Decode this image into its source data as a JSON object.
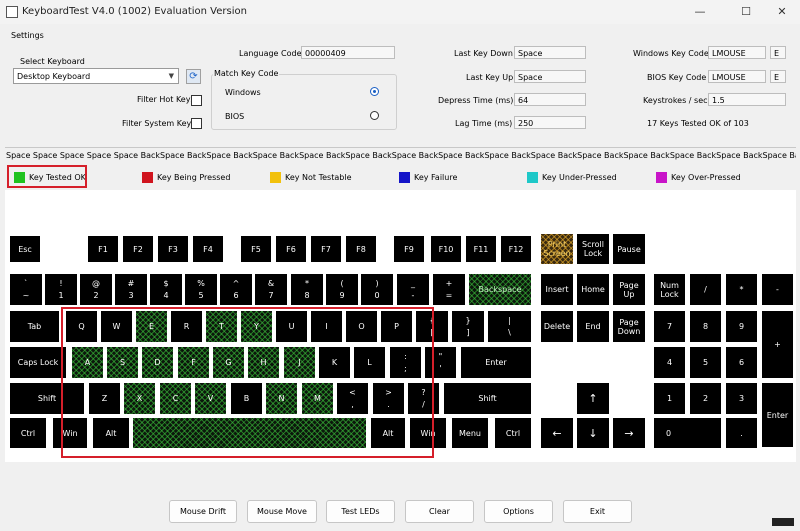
{
  "window": {
    "title": "KeyboardTest V4.0 (1002) Evaluation Version",
    "minimize": "—",
    "maximize": "☐",
    "close": "✕"
  },
  "settings": {
    "legend": "Settings",
    "select_keyboard_label": "Select Keyboard",
    "keyboard_value": "Desktop Keyboard",
    "filter_hot_keys": "Filter Hot Keys",
    "filter_system_keys": "Filter System Keys",
    "language_code_label": "Language Code",
    "language_code": "00000409",
    "match_key_code_label": "Match Key Code",
    "match_windows": "Windows",
    "match_bios": "BIOS",
    "last_key_down_label": "Last Key Down",
    "last_key_down": "Space",
    "last_key_up_label": "Last Key Up",
    "last_key_up": "Space",
    "depress_time_label": "Depress Time (ms)",
    "depress_time": "64",
    "lag_time_label": "Lag Time (ms)",
    "lag_time": "250",
    "windows_key_code_label": "Windows Key Code",
    "windows_key_code": "LMOUSE",
    "windows_key_code_extra": "E",
    "bios_key_code_label": "BIOS Key Code",
    "bios_key_code": "LMOUSE",
    "bios_key_code_extra": "E",
    "keystrokes_label": "Keystrokes / sec",
    "keystrokes": "1.5",
    "tested_summary": "17 Keys Tested OK of 103"
  },
  "ticker": "Space Space Space Space Space BackSpace BackSpace BackSpace BackSpace BackSpace BackSpace BackSpace BackSpace BackSpace BackSpace BackSpace BackSpace BackSpace BackSpace BackSpace BackSpace BackSpace Bac",
  "legend": {
    "tested_ok": "Key Tested OK",
    "being_pressed": "Key Being Pressed",
    "not_testable": "Key Not Testable",
    "failure": "Key Failure",
    "under_pressed": "Key Under-Pressed",
    "over_pressed": "Key Over-Pressed"
  },
  "colors": {
    "tested_ok": "#1fc21f",
    "being_pressed": "#d0141e",
    "not_testable": "#f2c10c",
    "failure": "#1414c8",
    "under_pressed": "#1ec8c8",
    "over_pressed": "#c814c8",
    "highlight": "#d51f2a"
  },
  "keys": {
    "esc": "Esc",
    "f1": "F1",
    "f2": "F2",
    "f3": "F3",
    "f4": "F4",
    "f5": "F5",
    "f6": "F6",
    "f7": "F7",
    "f8": "F8",
    "f9": "F9",
    "f10": "F10",
    "f11": "F11",
    "f12": "F12",
    "print_screen": "Print Screen",
    "scroll_lock": "Scroll Lock",
    "pause": "Pause",
    "tilde_top": "`",
    "tilde_bot": "~",
    "n1_top": "!",
    "n1_bot": "1",
    "n2_top": "@",
    "n2_bot": "2",
    "n3_top": "#",
    "n3_bot": "3",
    "n4_top": "$",
    "n4_bot": "4",
    "n5_top": "%",
    "n5_bot": "5",
    "n6_top": "^",
    "n6_bot": "6",
    "n7_top": "&",
    "n7_bot": "7",
    "n8_top": "*",
    "n8_bot": "8",
    "n9_top": "(",
    "n9_bot": "9",
    "n0_top": ")",
    "n0_bot": "0",
    "minus_top": "_",
    "minus_bot": "-",
    "equal_top": "+",
    "equal_bot": "=",
    "backspace": "Backspace",
    "insert": "Insert",
    "home": "Home",
    "page_up": "Page Up",
    "num_lock": "Num Lock",
    "np_div": "/",
    "np_mul": "*",
    "np_minus": "-",
    "tab": "Tab",
    "q": "Q",
    "w": "W",
    "e": "E",
    "r": "R",
    "t": "T",
    "y": "Y",
    "u": "U",
    "i": "I",
    "o": "O",
    "p": "P",
    "lbrace_top": "{",
    "lbrace_bot": "[",
    "rbrace_top": "}",
    "rbrace_bot": "]",
    "pipe_top": "|",
    "pipe_bot": "\\",
    "delete": "Delete",
    "end": "End",
    "page_down": "Page Down",
    "np7": "7",
    "np8": "8",
    "np9": "9",
    "np_plus": "+",
    "caps_lock": "Caps Lock",
    "a": "A",
    "s": "S",
    "d": "D",
    "f": "F",
    "g": "G",
    "h": "H",
    "j": "J",
    "k": "K",
    "l": "L",
    "semi_top": ":",
    "semi_bot": ";",
    "quote_top": "\"",
    "quote_bot": "'",
    "enter": "Enter",
    "np4": "4",
    "np5": "5",
    "np6": "6",
    "lshift": "Shift",
    "z": "Z",
    "x": "X",
    "c": "C",
    "v": "V",
    "b": "B",
    "n": "N",
    "m": "M",
    "comma_top": "<",
    "comma_bot": ",",
    "period_top": ">",
    "period_bot": ".",
    "slash_top": "?",
    "slash_bot": "/",
    "rshift": "Shift",
    "up": "↑",
    "np1": "1",
    "np2": "2",
    "np3": "3",
    "np_enter": "Enter",
    "lctrl": "Ctrl",
    "lwin": "Win",
    "lalt": "Alt",
    "ralt": "Alt",
    "rwin": "Win",
    "menu": "Menu",
    "rctrl": "Ctrl",
    "left": "←",
    "down": "↓",
    "right": "→",
    "np0": "0",
    "np_dot": "."
  },
  "buttons": {
    "mouse_drift": "Mouse Drift",
    "mouse_move": "Mouse Move",
    "test_leds": "Test LEDs",
    "clear": "Clear",
    "options": "Options",
    "exit": "Exit"
  }
}
